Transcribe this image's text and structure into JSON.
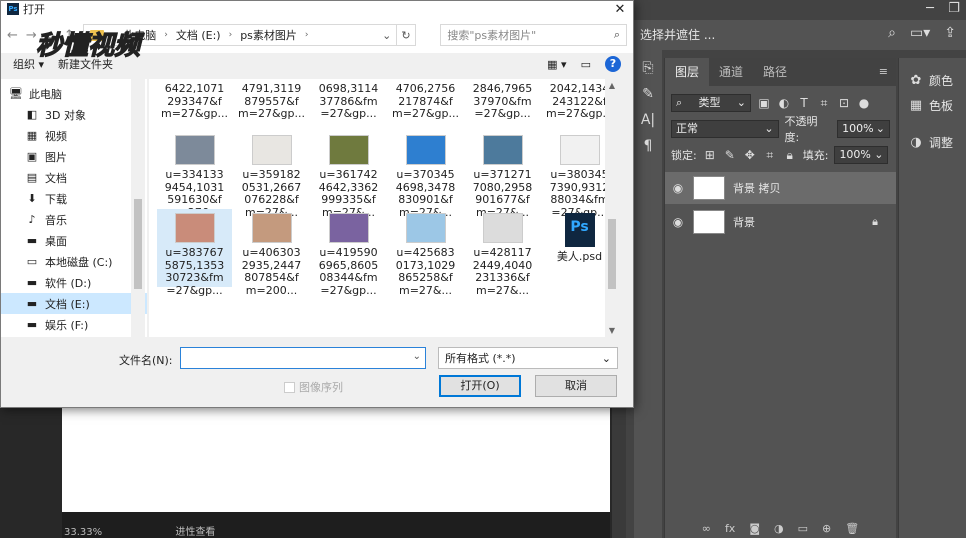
{
  "dialog": {
    "title": "打开",
    "close_glyph": "✕",
    "path": [
      "此电脑",
      "文档 (E:)",
      "ps素材图片"
    ],
    "search_placeholder": "搜索\"ps素材图片\"",
    "toolbar": {
      "organize": "组织 ▾",
      "new_folder": "新建文件夹"
    },
    "nav_items": [
      {
        "label": "此电脑",
        "icon": "computer-icon",
        "level": 0,
        "glyph": "🖥"
      },
      {
        "label": "3D 对象",
        "icon": "cube-icon",
        "level": 1,
        "glyph": "◧"
      },
      {
        "label": "视频",
        "icon": "video-icon",
        "level": 1,
        "glyph": "▦"
      },
      {
        "label": "图片",
        "icon": "picture-icon",
        "level": 1,
        "glyph": "▣"
      },
      {
        "label": "文档",
        "icon": "document-icon",
        "level": 1,
        "glyph": "▤"
      },
      {
        "label": "下载",
        "icon": "download-icon",
        "level": 1,
        "glyph": "⬇"
      },
      {
        "label": "音乐",
        "icon": "music-icon",
        "level": 1,
        "glyph": "♪"
      },
      {
        "label": "桌面",
        "icon": "desktop-icon",
        "level": 1,
        "glyph": "▬"
      },
      {
        "label": "本地磁盘 (C:)",
        "icon": "drive-icon",
        "level": 1,
        "glyph": "▭"
      },
      {
        "label": "软件 (D:)",
        "icon": "drive-icon",
        "level": 1,
        "glyph": "▬"
      },
      {
        "label": "文档 (E:)",
        "icon": "drive-icon",
        "level": 1,
        "glyph": "▬",
        "selected": true
      },
      {
        "label": "娱乐 (F:)",
        "icon": "drive-icon",
        "level": 1,
        "glyph": "▬"
      }
    ],
    "files_top": [
      "6422,1071\n293347&f\nm=27&gp...",
      "4791,3119\n879557&f\nm=27&gp...",
      "0698,3114\n37786&fm\n=27&gp...",
      "4706,2756\n217874&f\nm=27&gp...",
      "2846,7965\n37970&fm\n=27&gp...",
      "2042,1434\n243122&f\nm=27&gp..."
    ],
    "files": [
      {
        "name": "u=334133\n9454,1031\n591630&f\nm=27&...",
        "color": "#7d8a9a"
      },
      {
        "name": "u=359182\n0531,2667\n076228&f\nm=27&...",
        "color": "#e8e6e2"
      },
      {
        "name": "u=361742\n4642,3362\n999335&f\nm=27&...",
        "color": "#6f7a3e"
      },
      {
        "name": "u=370345\n4698,3478\n830901&f\nm=27&...",
        "color": "#2e7fd0"
      },
      {
        "name": "u=371271\n7080,2958\n901677&f\nm=27&...",
        "color": "#4d7a9c"
      },
      {
        "name": "u=380345\n7390,9312\n88034&fm\n=27&gp...",
        "color": "#f1f1f1"
      },
      {
        "name": "u=383767\n5875,1353\n30723&fm\n=27&gp...",
        "color": "#c98c7a",
        "selected": true
      },
      {
        "name": "u=406303\n2935,2447\n807854&f\nm=200...",
        "color": "#c49a7e"
      },
      {
        "name": "u=419590\n6965,8605\n08344&fm\n=27&gp...",
        "color": "#7a63a0"
      },
      {
        "name": "u=425683\n0173,1029\n865258&f\nm=27&...",
        "color": "#9cc7e6"
      },
      {
        "name": "u=428117\n2449,4040\n231336&f\nm=27&...",
        "color": "#dcdcdc"
      },
      {
        "name": "美人.psd",
        "color": "psd"
      }
    ],
    "filename_label": "文件名(N):",
    "filename_value": "",
    "filetype": "所有格式 (*.*)",
    "image_sequence": "图像序列",
    "open_button": "打开(O)",
    "cancel_button": "取消"
  },
  "photoshop": {
    "select_and_mask": "选择并遮住 ...",
    "panel_tabs": [
      "图层",
      "通道",
      "路径"
    ],
    "filter_kind": "类型",
    "blend_mode": "正常",
    "opacity_label": "不透明度:",
    "opacity_value": "100%",
    "lock_label": "锁定:",
    "fill_label": "填充:",
    "fill_value": "100%",
    "layers": [
      {
        "name": "背景 拷贝",
        "selected": true
      },
      {
        "name": "背景",
        "locked": true
      }
    ],
    "right_panels": [
      {
        "label": "颜色",
        "icon": "palette-icon",
        "glyph": "🎨"
      },
      {
        "label": "色板",
        "icon": "swatches-icon",
        "glyph": "▦"
      },
      {
        "label": "调整",
        "icon": "adjustments-icon",
        "glyph": "◑"
      }
    ],
    "status": [
      "33.33%",
      "进性查看"
    ]
  },
  "watermark": {
    "text": "秒懂视频"
  }
}
